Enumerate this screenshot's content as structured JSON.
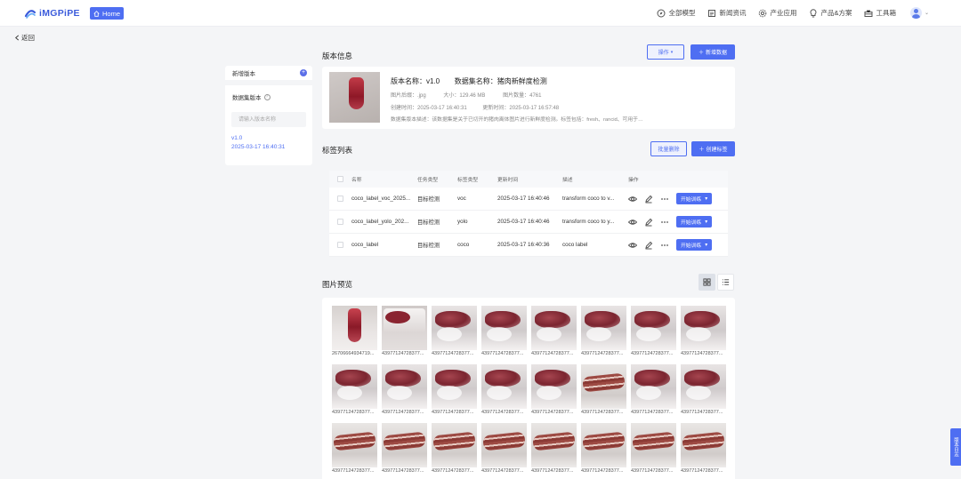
{
  "app": {
    "logo_text": "iMGPiPE",
    "home_label": "Home"
  },
  "nav": {
    "items": [
      {
        "label": "全部模型",
        "icon": "compass-icon"
      },
      {
        "label": "新闻资讯",
        "icon": "news-icon"
      },
      {
        "label": "产业应用",
        "icon": "settings-icon"
      },
      {
        "label": "产品&方案",
        "icon": "bulb-icon"
      },
      {
        "label": "工具箱",
        "icon": "toolbox-icon"
      }
    ]
  },
  "back_label": "返回",
  "sidebar": {
    "new_version_label": "新增版本",
    "dataset_version_label": "数据集版本",
    "search_placeholder": "请输入版本名称",
    "versions": [
      {
        "name": "v1.0",
        "date": "2025-03-17 16:40:31"
      }
    ]
  },
  "version_info": {
    "section_title": "版本信息",
    "operate_button": "操作",
    "add_data_button": "新增数据",
    "version_name_label": "版本名称：",
    "version_name": "v1.0",
    "dataset_name_label": "数据集名称：",
    "dataset_name": "猪肉新鲜度检测",
    "format_label": "图片后缀：",
    "format": ".jpg",
    "size_label": "大小：",
    "size": "129.46 MB",
    "count_label": "图片数量：",
    "count": "4761",
    "created_label": "创建时间：",
    "created": "2025-03-17 16:40:31",
    "updated_label": "更新时间：",
    "updated": "2025-03-17 16:57:48",
    "description": "数据集版本描述：该数据集是关于已切开的猪肉离体图片进行新鲜度检测。标签包括：fresh、rancid、可用于…"
  },
  "labels": {
    "section_title": "标签列表",
    "batch_delete_button": "批量删除",
    "create_label_button": "创建标签",
    "columns": [
      "名称",
      "任务类型",
      "标签类型",
      "更新时间",
      "描述",
      "操作"
    ],
    "rows": [
      {
        "name": "coco_label_voc_2025...",
        "task": "目标检测",
        "type": "voc",
        "time": "2025-03-17 16:40:46",
        "desc": "transform coco to v...",
        "train": "开始训练"
      },
      {
        "name": "coco_label_yolo_202...",
        "task": "目标检测",
        "type": "yolo",
        "time": "2025-03-17 16:40:46",
        "desc": "transform coco to y...",
        "train": "开始训练"
      },
      {
        "name": "coco_label",
        "task": "目标检测",
        "type": "coco",
        "time": "2025-03-17 16:40:36",
        "desc": "coco label",
        "train": "开始训练"
      }
    ]
  },
  "preview": {
    "section_title": "图片预览",
    "images": [
      {
        "caption": "26706664934719...",
        "style": "meat-a"
      },
      {
        "caption": "43977124728377...",
        "style": "meat-d"
      },
      {
        "caption": "43977124728377...",
        "style": "meat-b"
      },
      {
        "caption": "43977124728377...",
        "style": "meat-b"
      },
      {
        "caption": "43977124728377...",
        "style": "meat-b"
      },
      {
        "caption": "43977124728377...",
        "style": "meat-b"
      },
      {
        "caption": "43977124728377...",
        "style": "meat-b"
      },
      {
        "caption": "43977124728377...",
        "style": "meat-b"
      },
      {
        "caption": "43977124728377...",
        "style": "meat-b"
      },
      {
        "caption": "43977124728377...",
        "style": "meat-b"
      },
      {
        "caption": "43977124728377...",
        "style": "meat-b"
      },
      {
        "caption": "43977124728377...",
        "style": "meat-b"
      },
      {
        "caption": "43977124728377...",
        "style": "meat-b"
      },
      {
        "caption": "43977124728377...",
        "style": "meat-c"
      },
      {
        "caption": "43977124728377...",
        "style": "meat-b"
      },
      {
        "caption": "43977124728377...",
        "style": "meat-b"
      },
      {
        "caption": "43977124728377...",
        "style": "meat-c"
      },
      {
        "caption": "43977124728377...",
        "style": "meat-c"
      },
      {
        "caption": "43977124728377...",
        "style": "meat-c"
      },
      {
        "caption": "43977124728377...",
        "style": "meat-c"
      },
      {
        "caption": "43977124728377...",
        "style": "meat-c"
      },
      {
        "caption": "43977124728377...",
        "style": "meat-c"
      },
      {
        "caption": "43977124728377...",
        "style": "meat-c"
      },
      {
        "caption": "43977124728377...",
        "style": "meat-c"
      }
    ]
  },
  "float_tab_label": "版本日志",
  "colors": {
    "primary": "#4e6ef2",
    "background": "#f4f5f7"
  }
}
